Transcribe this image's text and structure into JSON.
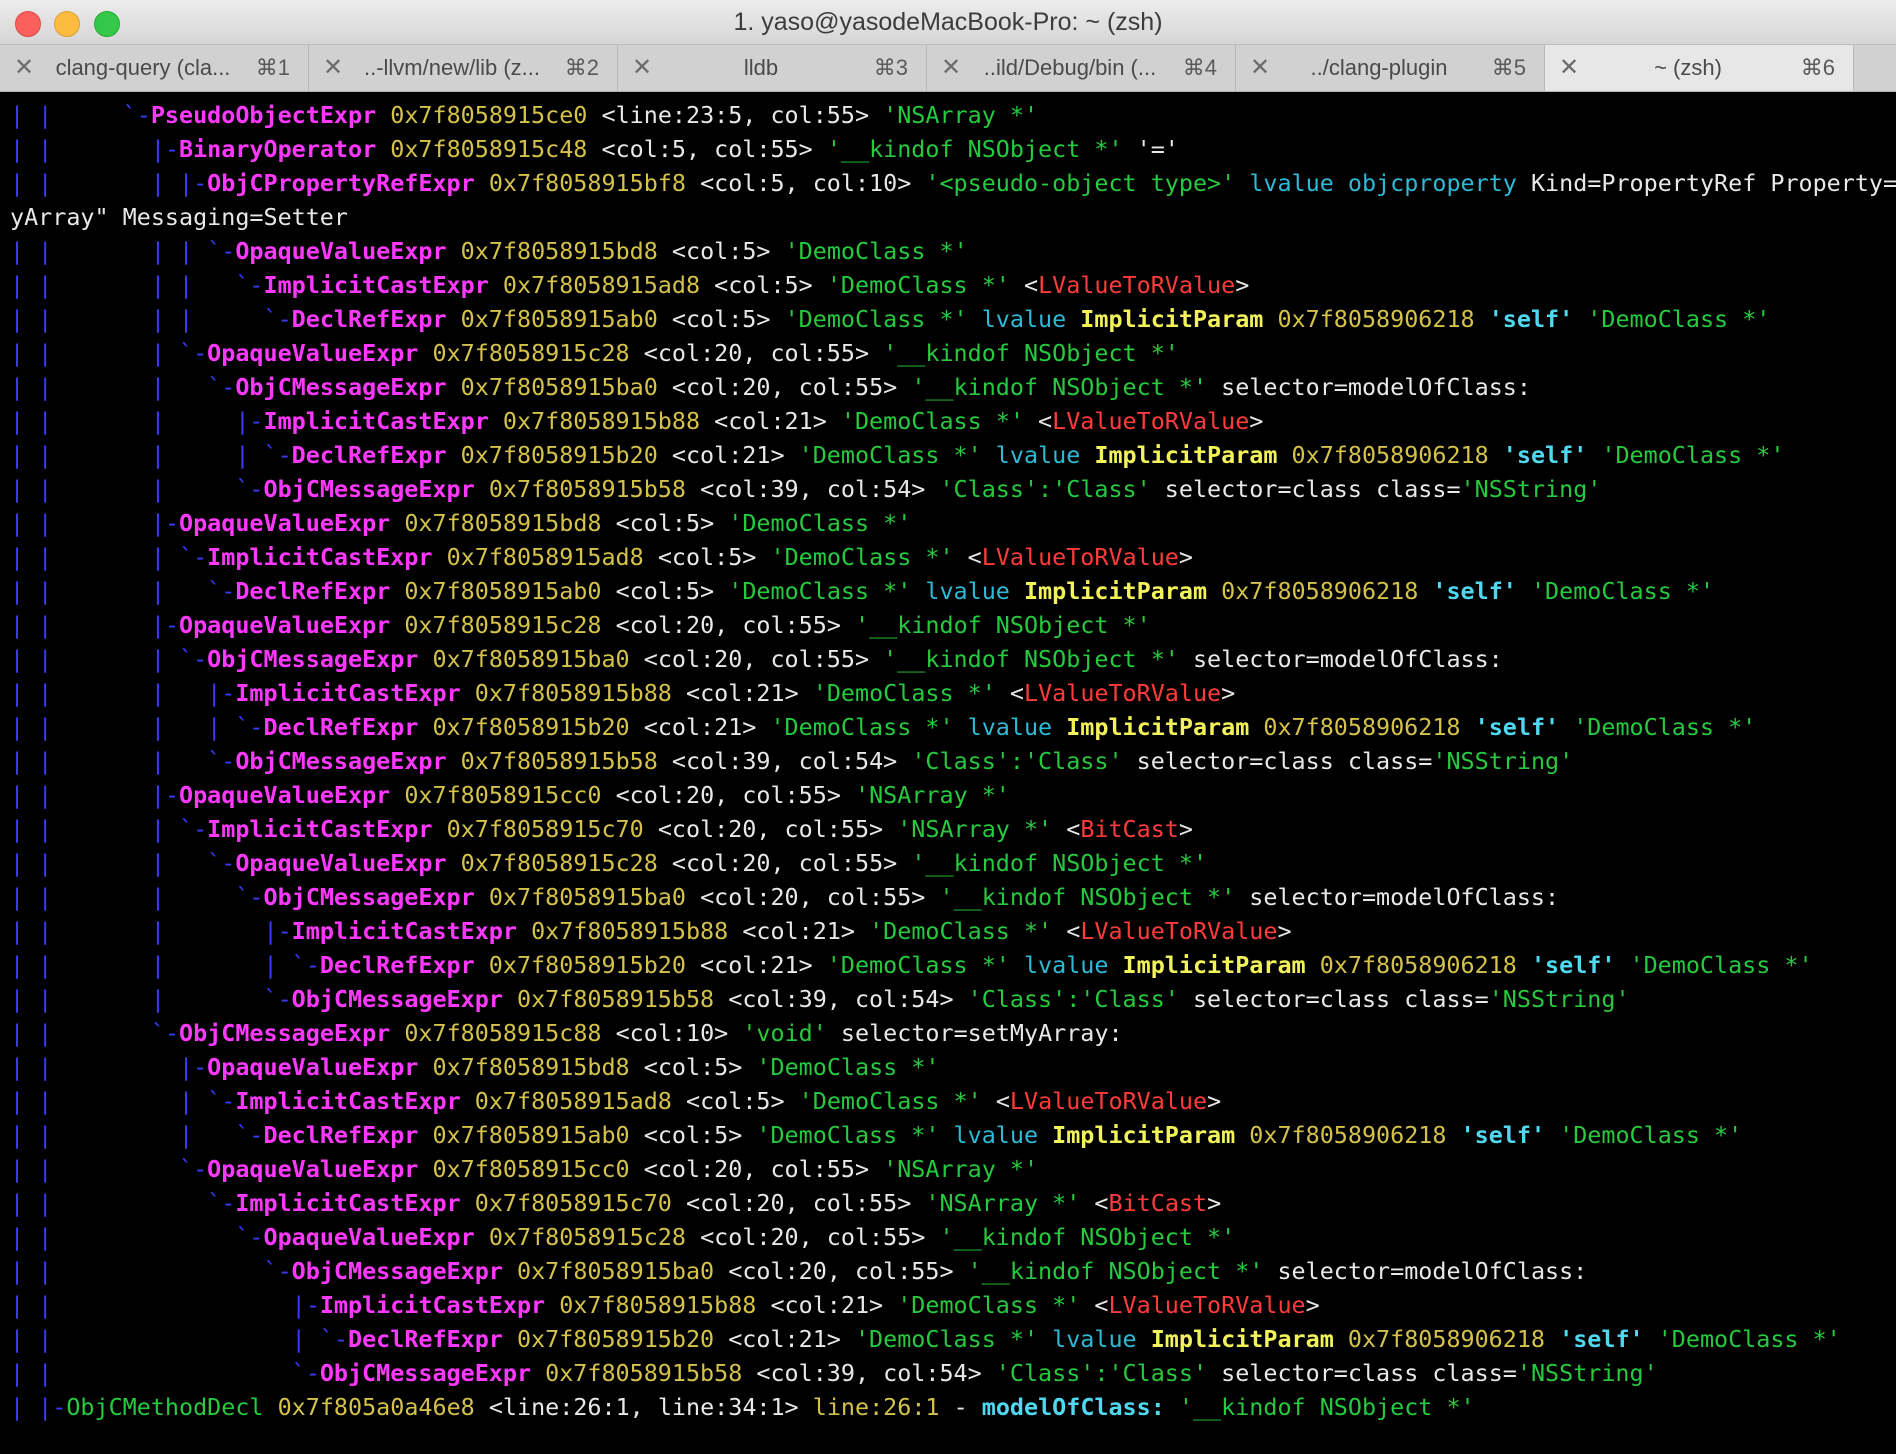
{
  "window": {
    "title": "1. yaso@yasodeMacBook-Pro: ~ (zsh)"
  },
  "tabs": [
    {
      "label": "clang-query (cla...",
      "shortcut": "⌘1",
      "active": false
    },
    {
      "label": "..-llvm/new/lib (z...",
      "shortcut": "⌘2",
      "active": false
    },
    {
      "label": "lldb",
      "shortcut": "⌘3",
      "active": false
    },
    {
      "label": "..ild/Debug/bin (...",
      "shortcut": "⌘4",
      "active": false
    },
    {
      "label": "../clang-plugin",
      "shortcut": "⌘5",
      "active": false
    },
    {
      "label": "~ (zsh)",
      "shortcut": "⌘6",
      "active": true
    }
  ],
  "terminal": {
    "lines": [
      [
        [
          "t",
          "| |     `-"
        ],
        [
          "n",
          "PseudoObjectExpr"
        ],
        [
          "a",
          " 0x7f8058915ce0"
        ],
        [
          "p",
          " <line:23:5, col:55>"
        ],
        [
          "g",
          " 'NSArray *'"
        ]
      ],
      [
        [
          "t",
          "| |       |-"
        ],
        [
          "n",
          "BinaryOperator"
        ],
        [
          "a",
          " 0x7f8058915c48"
        ],
        [
          "p",
          " <col:5, col:55>"
        ],
        [
          "g",
          " '__kindof NSObject *'"
        ],
        [
          "w",
          " '='"
        ]
      ],
      [
        [
          "t",
          "| |       | |-"
        ],
        [
          "n",
          "ObjCPropertyRefExpr"
        ],
        [
          "a",
          " 0x7f8058915bf8"
        ],
        [
          "p",
          " <col:5, col:10>"
        ],
        [
          "g",
          " '<pseudo-object type>'"
        ],
        [
          "c",
          " lvalue objcproperty"
        ],
        [
          "w",
          " Kind=PropertyRef Property=\"m"
        ]
      ],
      [
        [
          "w",
          "yArray\" Messaging=Setter"
        ]
      ],
      [
        [
          "t",
          "| |       | | `-"
        ],
        [
          "n",
          "OpaqueValueExpr"
        ],
        [
          "a",
          " 0x7f8058915bd8"
        ],
        [
          "p",
          " <col:5>"
        ],
        [
          "g",
          " 'DemoClass *'"
        ]
      ],
      [
        [
          "t",
          "| |       | |   `-"
        ],
        [
          "n",
          "ImplicitCastExpr"
        ],
        [
          "a",
          " 0x7f8058915ad8"
        ],
        [
          "p",
          " <col:5>"
        ],
        [
          "g",
          " 'DemoClass *'"
        ],
        [
          "w",
          " <"
        ],
        [
          "r",
          "LValueToRValue"
        ],
        [
          "w",
          ">"
        ]
      ],
      [
        [
          "t",
          "| |       | |     `-"
        ],
        [
          "n",
          "DeclRefExpr"
        ],
        [
          "a",
          " 0x7f8058915ab0"
        ],
        [
          "p",
          " <col:5>"
        ],
        [
          "g",
          " 'DemoClass *'"
        ],
        [
          "c",
          " lvalue"
        ],
        [
          "y",
          " ImplicitParam"
        ],
        [
          "a",
          " 0x7f8058906218"
        ],
        [
          "cb",
          " 'self'"
        ],
        [
          "g",
          " 'DemoClass *'"
        ]
      ],
      [
        [
          "t",
          "| |       | `-"
        ],
        [
          "n",
          "OpaqueValueExpr"
        ],
        [
          "a",
          " 0x7f8058915c28"
        ],
        [
          "p",
          " <col:20, col:55>"
        ],
        [
          "g",
          " '__kindof NSObject *'"
        ]
      ],
      [
        [
          "t",
          "| |       |   `-"
        ],
        [
          "n",
          "ObjCMessageExpr"
        ],
        [
          "a",
          " 0x7f8058915ba0"
        ],
        [
          "p",
          " <col:20, col:55>"
        ],
        [
          "g",
          " '__kindof NSObject *'"
        ],
        [
          "w",
          " selector=modelOfClass:"
        ]
      ],
      [
        [
          "t",
          "| |       |     |-"
        ],
        [
          "n",
          "ImplicitCastExpr"
        ],
        [
          "a",
          " 0x7f8058915b88"
        ],
        [
          "p",
          " <col:21>"
        ],
        [
          "g",
          " 'DemoClass *'"
        ],
        [
          "w",
          " <"
        ],
        [
          "r",
          "LValueToRValue"
        ],
        [
          "w",
          ">"
        ]
      ],
      [
        [
          "t",
          "| |       |     | `-"
        ],
        [
          "n",
          "DeclRefExpr"
        ],
        [
          "a",
          " 0x7f8058915b20"
        ],
        [
          "p",
          " <col:21>"
        ],
        [
          "g",
          " 'DemoClass *'"
        ],
        [
          "c",
          " lvalue"
        ],
        [
          "y",
          " ImplicitParam"
        ],
        [
          "a",
          " 0x7f8058906218"
        ],
        [
          "cb",
          " 'self'"
        ],
        [
          "g",
          " 'DemoClass *'"
        ]
      ],
      [
        [
          "t",
          "| |       |     `-"
        ],
        [
          "n",
          "ObjCMessageExpr"
        ],
        [
          "a",
          " 0x7f8058915b58"
        ],
        [
          "p",
          " <col:39, col:54>"
        ],
        [
          "g",
          " 'Class':'Class'"
        ],
        [
          "w",
          " selector=class class="
        ],
        [
          "g",
          "'NSString'"
        ]
      ],
      [
        [
          "t",
          "| |       |-"
        ],
        [
          "n",
          "OpaqueValueExpr"
        ],
        [
          "a",
          " 0x7f8058915bd8"
        ],
        [
          "p",
          " <col:5>"
        ],
        [
          "g",
          " 'DemoClass *'"
        ]
      ],
      [
        [
          "t",
          "| |       | `-"
        ],
        [
          "n",
          "ImplicitCastExpr"
        ],
        [
          "a",
          " 0x7f8058915ad8"
        ],
        [
          "p",
          " <col:5>"
        ],
        [
          "g",
          " 'DemoClass *'"
        ],
        [
          "w",
          " <"
        ],
        [
          "r",
          "LValueToRValue"
        ],
        [
          "w",
          ">"
        ]
      ],
      [
        [
          "t",
          "| |       |   `-"
        ],
        [
          "n",
          "DeclRefExpr"
        ],
        [
          "a",
          " 0x7f8058915ab0"
        ],
        [
          "p",
          " <col:5>"
        ],
        [
          "g",
          " 'DemoClass *'"
        ],
        [
          "c",
          " lvalue"
        ],
        [
          "y",
          " ImplicitParam"
        ],
        [
          "a",
          " 0x7f8058906218"
        ],
        [
          "cb",
          " 'self'"
        ],
        [
          "g",
          " 'DemoClass *'"
        ]
      ],
      [
        [
          "t",
          "| |       |-"
        ],
        [
          "n",
          "OpaqueValueExpr"
        ],
        [
          "a",
          " 0x7f8058915c28"
        ],
        [
          "p",
          " <col:20, col:55>"
        ],
        [
          "g",
          " '__kindof NSObject *'"
        ]
      ],
      [
        [
          "t",
          "| |       | `-"
        ],
        [
          "n",
          "ObjCMessageExpr"
        ],
        [
          "a",
          " 0x7f8058915ba0"
        ],
        [
          "p",
          " <col:20, col:55>"
        ],
        [
          "g",
          " '__kindof NSObject *'"
        ],
        [
          "w",
          " selector=modelOfClass:"
        ]
      ],
      [
        [
          "t",
          "| |       |   |-"
        ],
        [
          "n",
          "ImplicitCastExpr"
        ],
        [
          "a",
          " 0x7f8058915b88"
        ],
        [
          "p",
          " <col:21>"
        ],
        [
          "g",
          " 'DemoClass *'"
        ],
        [
          "w",
          " <"
        ],
        [
          "r",
          "LValueToRValue"
        ],
        [
          "w",
          ">"
        ]
      ],
      [
        [
          "t",
          "| |       |   | `-"
        ],
        [
          "n",
          "DeclRefExpr"
        ],
        [
          "a",
          " 0x7f8058915b20"
        ],
        [
          "p",
          " <col:21>"
        ],
        [
          "g",
          " 'DemoClass *'"
        ],
        [
          "c",
          " lvalue"
        ],
        [
          "y",
          " ImplicitParam"
        ],
        [
          "a",
          " 0x7f8058906218"
        ],
        [
          "cb",
          " 'self'"
        ],
        [
          "g",
          " 'DemoClass *'"
        ]
      ],
      [
        [
          "t",
          "| |       |   `-"
        ],
        [
          "n",
          "ObjCMessageExpr"
        ],
        [
          "a",
          " 0x7f8058915b58"
        ],
        [
          "p",
          " <col:39, col:54>"
        ],
        [
          "g",
          " 'Class':'Class'"
        ],
        [
          "w",
          " selector=class class="
        ],
        [
          "g",
          "'NSString'"
        ]
      ],
      [
        [
          "t",
          "| |       |-"
        ],
        [
          "n",
          "OpaqueValueExpr"
        ],
        [
          "a",
          " 0x7f8058915cc0"
        ],
        [
          "p",
          " <col:20, col:55>"
        ],
        [
          "g",
          " 'NSArray *'"
        ]
      ],
      [
        [
          "t",
          "| |       | `-"
        ],
        [
          "n",
          "ImplicitCastExpr"
        ],
        [
          "a",
          " 0x7f8058915c70"
        ],
        [
          "p",
          " <col:20, col:55>"
        ],
        [
          "g",
          " 'NSArray *'"
        ],
        [
          "w",
          " <"
        ],
        [
          "r",
          "BitCast"
        ],
        [
          "w",
          ">"
        ]
      ],
      [
        [
          "t",
          "| |       |   `-"
        ],
        [
          "n",
          "OpaqueValueExpr"
        ],
        [
          "a",
          " 0x7f8058915c28"
        ],
        [
          "p",
          " <col:20, col:55>"
        ],
        [
          "g",
          " '__kindof NSObject *'"
        ]
      ],
      [
        [
          "t",
          "| |       |     `-"
        ],
        [
          "n",
          "ObjCMessageExpr"
        ],
        [
          "a",
          " 0x7f8058915ba0"
        ],
        [
          "p",
          " <col:20, col:55>"
        ],
        [
          "g",
          " '__kindof NSObject *'"
        ],
        [
          "w",
          " selector=modelOfClass:"
        ]
      ],
      [
        [
          "t",
          "| |       |       |-"
        ],
        [
          "n",
          "ImplicitCastExpr"
        ],
        [
          "a",
          " 0x7f8058915b88"
        ],
        [
          "p",
          " <col:21>"
        ],
        [
          "g",
          " 'DemoClass *'"
        ],
        [
          "w",
          " <"
        ],
        [
          "r",
          "LValueToRValue"
        ],
        [
          "w",
          ">"
        ]
      ],
      [
        [
          "t",
          "| |       |       | `-"
        ],
        [
          "n",
          "DeclRefExpr"
        ],
        [
          "a",
          " 0x7f8058915b20"
        ],
        [
          "p",
          " <col:21>"
        ],
        [
          "g",
          " 'DemoClass *'"
        ],
        [
          "c",
          " lvalue"
        ],
        [
          "y",
          " ImplicitParam"
        ],
        [
          "a",
          " 0x7f8058906218"
        ],
        [
          "cb",
          " 'self'"
        ],
        [
          "g",
          " 'DemoClass *'"
        ]
      ],
      [
        [
          "t",
          "| |       |       `-"
        ],
        [
          "n",
          "ObjCMessageExpr"
        ],
        [
          "a",
          " 0x7f8058915b58"
        ],
        [
          "p",
          " <col:39, col:54>"
        ],
        [
          "g",
          " 'Class':'Class'"
        ],
        [
          "w",
          " selector=class class="
        ],
        [
          "g",
          "'NSString'"
        ]
      ],
      [
        [
          "t",
          "| |       `-"
        ],
        [
          "n",
          "ObjCMessageExpr"
        ],
        [
          "a",
          " 0x7f8058915c88"
        ],
        [
          "p",
          " <col:10>"
        ],
        [
          "g",
          " 'void'"
        ],
        [
          "w",
          " selector=setMyArray:"
        ]
      ],
      [
        [
          "t",
          "| |         |-"
        ],
        [
          "n",
          "OpaqueValueExpr"
        ],
        [
          "a",
          " 0x7f8058915bd8"
        ],
        [
          "p",
          " <col:5>"
        ],
        [
          "g",
          " 'DemoClass *'"
        ]
      ],
      [
        [
          "t",
          "| |         | `-"
        ],
        [
          "n",
          "ImplicitCastExpr"
        ],
        [
          "a",
          " 0x7f8058915ad8"
        ],
        [
          "p",
          " <col:5>"
        ],
        [
          "g",
          " 'DemoClass *'"
        ],
        [
          "w",
          " <"
        ],
        [
          "r",
          "LValueToRValue"
        ],
        [
          "w",
          ">"
        ]
      ],
      [
        [
          "t",
          "| |         |   `-"
        ],
        [
          "n",
          "DeclRefExpr"
        ],
        [
          "a",
          " 0x7f8058915ab0"
        ],
        [
          "p",
          " <col:5>"
        ],
        [
          "g",
          " 'DemoClass *'"
        ],
        [
          "c",
          " lvalue"
        ],
        [
          "y",
          " ImplicitParam"
        ],
        [
          "a",
          " 0x7f8058906218"
        ],
        [
          "cb",
          " 'self'"
        ],
        [
          "g",
          " 'DemoClass *'"
        ]
      ],
      [
        [
          "t",
          "| |         `-"
        ],
        [
          "n",
          "OpaqueValueExpr"
        ],
        [
          "a",
          " 0x7f8058915cc0"
        ],
        [
          "p",
          " <col:20, col:55>"
        ],
        [
          "g",
          " 'NSArray *'"
        ]
      ],
      [
        [
          "t",
          "| |           `-"
        ],
        [
          "n",
          "ImplicitCastExpr"
        ],
        [
          "a",
          " 0x7f8058915c70"
        ],
        [
          "p",
          " <col:20, col:55>"
        ],
        [
          "g",
          " 'NSArray *'"
        ],
        [
          "w",
          " <"
        ],
        [
          "r",
          "BitCast"
        ],
        [
          "w",
          ">"
        ]
      ],
      [
        [
          "t",
          "| |             `-"
        ],
        [
          "n",
          "OpaqueValueExpr"
        ],
        [
          "a",
          " 0x7f8058915c28"
        ],
        [
          "p",
          " <col:20, col:55>"
        ],
        [
          "g",
          " '__kindof NSObject *'"
        ]
      ],
      [
        [
          "t",
          "| |               `-"
        ],
        [
          "n",
          "ObjCMessageExpr"
        ],
        [
          "a",
          " 0x7f8058915ba0"
        ],
        [
          "p",
          " <col:20, col:55>"
        ],
        [
          "g",
          " '__kindof NSObject *'"
        ],
        [
          "w",
          " selector=modelOfClass:"
        ]
      ],
      [
        [
          "t",
          "| |                 |-"
        ],
        [
          "n",
          "ImplicitCastExpr"
        ],
        [
          "a",
          " 0x7f8058915b88"
        ],
        [
          "p",
          " <col:21>"
        ],
        [
          "g",
          " 'DemoClass *'"
        ],
        [
          "w",
          " <"
        ],
        [
          "r",
          "LValueToRValue"
        ],
        [
          "w",
          ">"
        ]
      ],
      [
        [
          "t",
          "| |                 | `-"
        ],
        [
          "n",
          "DeclRefExpr"
        ],
        [
          "a",
          " 0x7f8058915b20"
        ],
        [
          "p",
          " <col:21>"
        ],
        [
          "g",
          " 'DemoClass *'"
        ],
        [
          "c",
          " lvalue"
        ],
        [
          "y",
          " ImplicitParam"
        ],
        [
          "a",
          " 0x7f8058906218"
        ],
        [
          "cb",
          " 'self'"
        ],
        [
          "g",
          " 'DemoClass *'"
        ]
      ],
      [
        [
          "t",
          "| |                 `-"
        ],
        [
          "n",
          "ObjCMessageExpr"
        ],
        [
          "a",
          " 0x7f8058915b58"
        ],
        [
          "p",
          " <col:39, col:54>"
        ],
        [
          "g",
          " 'Class':'Class'"
        ],
        [
          "w",
          " selector=class class="
        ],
        [
          "g",
          "'NSString'"
        ]
      ],
      [
        [
          "t",
          "| |-"
        ],
        [
          "g",
          "ObjCMethodDecl"
        ],
        [
          "a",
          " 0x7f805a0a46e8"
        ],
        [
          "p",
          " <line:26:1, line:34:1>"
        ],
        [
          "a",
          " line:26:1"
        ],
        [
          "w",
          " -"
        ],
        [
          "cb",
          " modelOfClass:"
        ],
        [
          "g",
          " '__kindof NSObject *'"
        ]
      ]
    ]
  }
}
